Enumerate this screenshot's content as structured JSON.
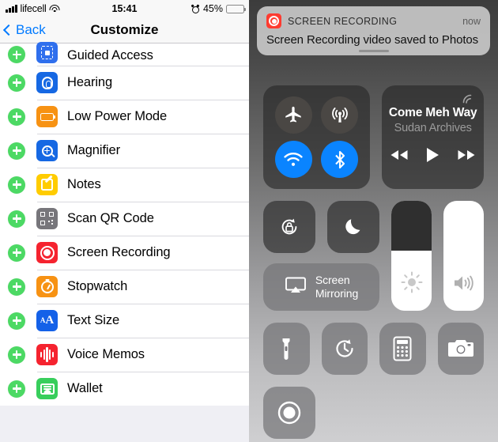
{
  "left": {
    "statusbar": {
      "carrier": "lifecell",
      "time": "15:41",
      "battery_percent": "45%",
      "signal_icon": "cellular-bars-icon",
      "wifi_icon": "wifi-icon",
      "alarm_icon": "alarm-clock-icon",
      "battery_icon": "battery-icon"
    },
    "nav": {
      "back_label": "Back",
      "title": "Customize",
      "back_icon": "chevron-left-icon"
    },
    "list": [
      {
        "label": "Guided Access",
        "icon": "guided-access-icon",
        "color": "#2F6FED",
        "add_icon": "plus-circle-icon",
        "clipped": true
      },
      {
        "label": "Hearing",
        "icon": "hearing-icon",
        "color": "#1668E3",
        "add_icon": "plus-circle-icon",
        "clipped": false
      },
      {
        "label": "Low Power Mode",
        "icon": "low-power-mode-icon",
        "color": "#F79213",
        "add_icon": "plus-circle-icon",
        "clipped": false
      },
      {
        "label": "Magnifier",
        "icon": "magnifier-icon",
        "color": "#1668E3",
        "add_icon": "plus-circle-icon",
        "clipped": false
      },
      {
        "label": "Notes",
        "icon": "notes-icon",
        "color": "#FFCC00",
        "add_icon": "plus-circle-icon",
        "clipped": false
      },
      {
        "label": "Scan QR Code",
        "icon": "scan-qr-code-icon",
        "color": "#77767B",
        "add_icon": "plus-circle-icon",
        "clipped": false
      },
      {
        "label": "Screen Recording",
        "icon": "screen-recording-icon",
        "color": "#F5232F",
        "add_icon": "plus-circle-icon",
        "clipped": false
      },
      {
        "label": "Stopwatch",
        "icon": "stopwatch-icon",
        "color": "#F79213",
        "add_icon": "plus-circle-icon",
        "clipped": false
      },
      {
        "label": "Text Size",
        "icon": "text-size-icon",
        "color": "#1461E8",
        "add_icon": "plus-circle-icon",
        "clipped": false
      },
      {
        "label": "Voice Memos",
        "icon": "voice-memos-icon",
        "color": "#F5232F",
        "add_icon": "plus-circle-icon",
        "clipped": false
      },
      {
        "label": "Wallet",
        "icon": "wallet-icon",
        "color": "#38CE5C",
        "add_icon": "plus-circle-icon",
        "clipped": false
      }
    ],
    "accent_color": "#007AFF",
    "add_button_color": "#4CD964"
  },
  "right": {
    "notification": {
      "app_name": "SCREEN RECORDING",
      "time": "now",
      "body": "Screen Recording video saved to Photos",
      "app_icon": "screen-recording-icon",
      "grabber": "drag-handle"
    },
    "connectivity": [
      {
        "name": "airplane-mode",
        "icon": "airplane-icon",
        "state": "off"
      },
      {
        "name": "cellular-data",
        "icon": "cellular-antenna-icon",
        "state": "off"
      },
      {
        "name": "wifi",
        "icon": "wifi-icon",
        "state": "on"
      },
      {
        "name": "bluetooth",
        "icon": "bluetooth-icon",
        "state": "on"
      }
    ],
    "now_playing": {
      "title": "Come Meh Way",
      "artist": "Sudan Archives",
      "airplay_icon": "airplay-audio-icon",
      "previous_icon": "rewind-icon",
      "play_icon": "play-icon",
      "next_icon": "fast-forward-icon"
    },
    "toggles": {
      "rotation_lock": {
        "icon": "rotation-lock-icon",
        "state": "off"
      },
      "do_not_disturb": {
        "icon": "moon-icon",
        "state": "off"
      }
    },
    "screen_mirroring": {
      "label_line1": "Screen",
      "label_line2": "Mirroring",
      "icon": "airplay-screen-icon"
    },
    "brightness": {
      "value": 55,
      "icon": "brightness-sun-icon"
    },
    "volume": {
      "value": 100,
      "icon": "speaker-waves-icon"
    },
    "shortcuts": [
      {
        "name": "flashlight",
        "icon": "flashlight-icon"
      },
      {
        "name": "timer",
        "icon": "timer-icon"
      },
      {
        "name": "calculator",
        "icon": "calculator-icon"
      },
      {
        "name": "camera",
        "icon": "camera-icon"
      }
    ],
    "screen_record_button": {
      "name": "screen-recording",
      "icon": "record-circle-icon"
    },
    "on_color": "#0A84FF",
    "off_color": "#4A4744"
  }
}
